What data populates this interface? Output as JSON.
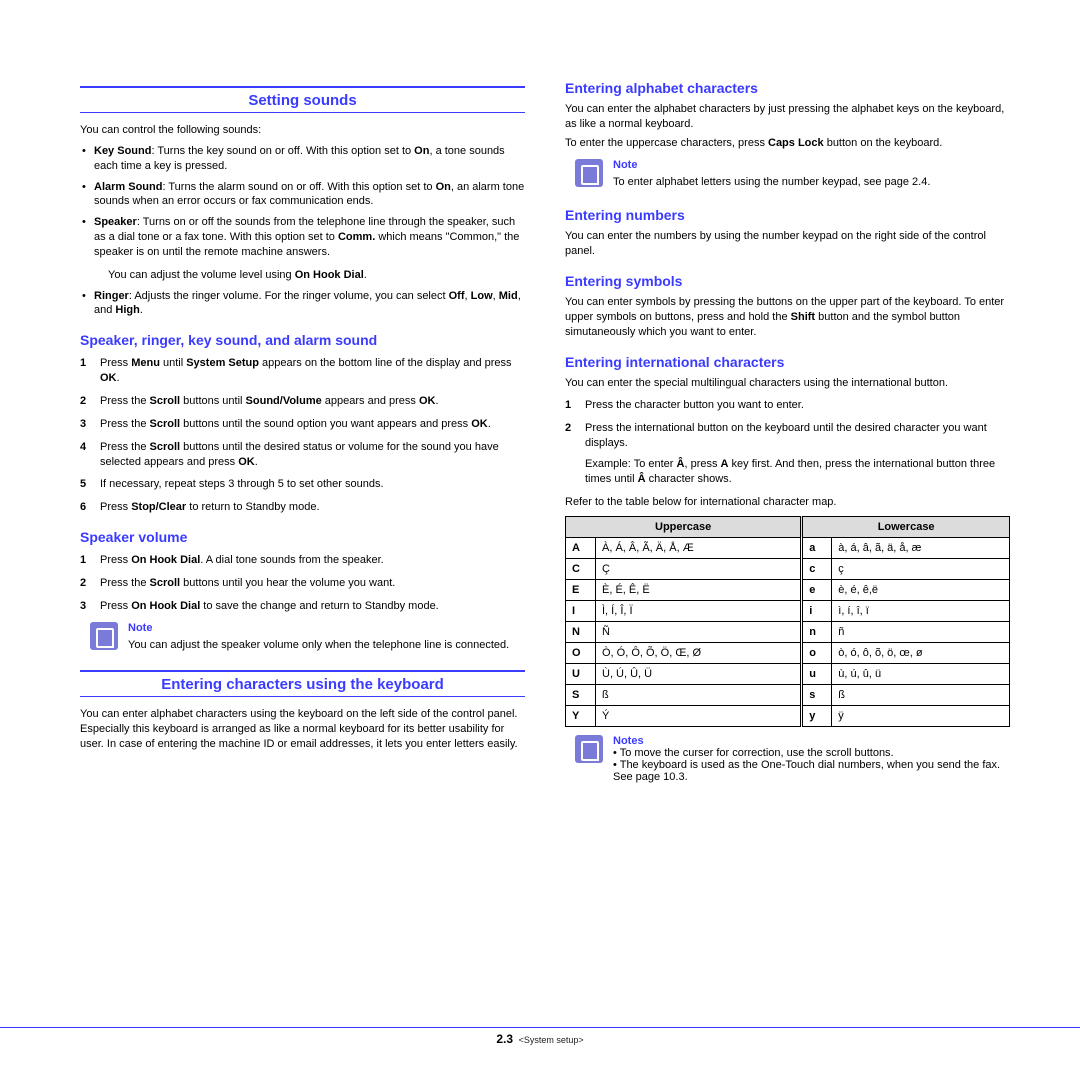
{
  "left": {
    "h1_sounds": "Setting sounds",
    "intro": "You can control the following sounds:",
    "bullets": {
      "keysound": "Key Sound: Turns the key sound on or off. With this option set to On, a tone sounds each time a key is pressed.",
      "alarmsound": "Alarm Sound: Turns the alarm sound on or off. With this option set to On, an alarm tone sounds when an error occurs or fax communication ends.",
      "speaker": "Speaker: Turns on or off the sounds from the telephone line through the speaker, such as a dial tone or a fax tone. With this option set to Comm. which means \"Common,\" the speaker is on until the remote machine answers.",
      "speaker_sub": "You can adjust the volume level using On Hook Dial.",
      "ringer": "Ringer: Adjusts the ringer volume. For the ringer volume, you can select Off, Low, Mid, and High."
    },
    "h2_speaker_ringer": "Speaker, ringer, key sound, and alarm sound",
    "steps1": [
      "Press Menu until System Setup appears on the bottom line of the display and press OK.",
      "Press the Scroll buttons until Sound/Volume appears and press OK.",
      "Press the Scroll buttons until the sound option you want appears and press OK.",
      "Press the Scroll buttons until the desired status or volume for the sound you have selected appears and press OK.",
      "If necessary, repeat steps 3 through 5 to set other sounds.",
      "Press Stop/Clear to return to Standby mode."
    ],
    "h2_speaker_vol": "Speaker volume",
    "steps2": [
      "Press On Hook Dial. A dial tone sounds from the speaker.",
      "Press the Scroll buttons until you hear the volume you want.",
      "Press On Hook Dial to save the change and return to Standby mode."
    ],
    "note1_title": "Note",
    "note1_body": "You can adjust the speaker volume only when the telephone line is connected.",
    "h1_keyboard": "Entering characters using the keyboard",
    "keyboard_p": "You can enter alphabet characters using the keyboard on the left side of the control panel. Especially this keyboard is arranged as like a normal keyboard for its better usability for user. In case of entering the machine ID or email addresses, it lets you enter letters easily."
  },
  "right": {
    "h2_alpha": "Entering alphabet characters",
    "alpha_p1": "You can enter the alphabet characters by just pressing the alphabet keys on the keyboard, as like a normal keyboard.",
    "alpha_p2": "To enter the uppercase characters, press Caps Lock button on the keyboard.",
    "note2_title": "Note",
    "note2_body": "To enter alphabet letters using the number keypad, see page 2.4.",
    "h2_numbers": "Entering numbers",
    "numbers_p": "You can enter the numbers by using the number keypad on the right side of the control panel.",
    "h2_symbols": "Entering symbols",
    "symbols_p": "You can enter symbols by pressing the buttons on the upper part of the keyboard. To enter upper symbols on buttons, press and hold the Shift button and the symbol button simutaneously which you want to enter.",
    "h2_intl": "Entering international characters",
    "intl_p": "You can enter the special multilingual characters using the international button.",
    "intl_steps": [
      "Press the character button you want to enter.",
      "Press the international button on the keyboard until the desired character you want displays."
    ],
    "intl_example": "Example: To enter Â, press A key first. And then, press the international button three times until Â character shows.",
    "intl_refer": "Refer to the table below for international character map.",
    "table": {
      "th_upper": "Uppercase",
      "th_lower": "Lowercase",
      "rows": [
        {
          "U": "A",
          "uv": "À, Á, Â, Ã, Ä, Å, Æ",
          "L": "a",
          "lv": "à, á, â, ã, ä, å, æ"
        },
        {
          "U": "C",
          "uv": "Ç",
          "L": "c",
          "lv": "ç"
        },
        {
          "U": "E",
          "uv": "È, É, Ê, Ë",
          "L": "e",
          "lv": "è, é, ê,ë"
        },
        {
          "U": "I",
          "uv": "Ì, Í, Î, Ï",
          "L": "i",
          "lv": "ì, í, î, ï"
        },
        {
          "U": "N",
          "uv": "Ñ",
          "L": "n",
          "lv": "ñ"
        },
        {
          "U": "O",
          "uv": "Ò, Ó, Ô, Õ, Ö, Œ, Ø",
          "L": "o",
          "lv": "ò, ó, ô, õ, ö, œ, ø"
        },
        {
          "U": "U",
          "uv": "Ù, Ú, Û, Ü",
          "L": "u",
          "lv": "ù, ú, û, ü"
        },
        {
          "U": "S",
          "uv": "ß",
          "L": "s",
          "lv": "ß"
        },
        {
          "U": "Y",
          "uv": "Ý",
          "L": "y",
          "lv": "ÿ"
        }
      ]
    },
    "notes_title": "Notes",
    "notes_b1": "To move the curser for correction, use the scroll buttons.",
    "notes_b2": "The keyboard is used as the One-Touch dial numbers, when you send the fax. See page 10.3."
  },
  "footer": {
    "page": "2.3",
    "section": "<System setup>"
  }
}
